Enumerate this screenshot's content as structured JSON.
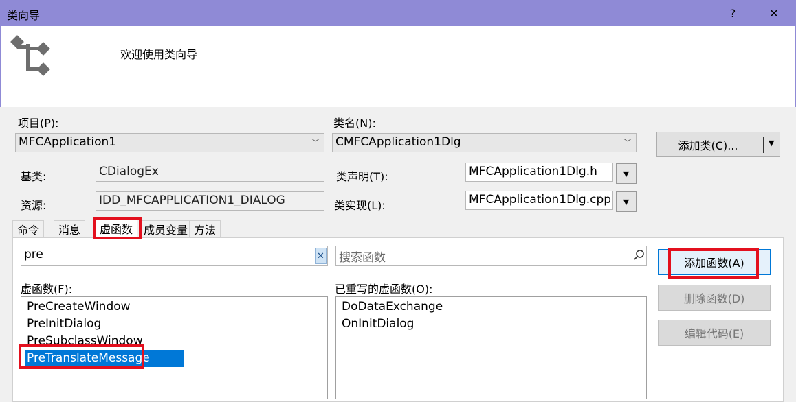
{
  "window": {
    "title": "类向导",
    "help_label": "?",
    "close_label": "✕"
  },
  "banner": {
    "welcome": "欢迎使用类向导",
    "icon": "class-hierarchy-icon"
  },
  "project": {
    "label": "项目(P):",
    "value": "MFCApplication1"
  },
  "classname": {
    "label": "类名(N):",
    "value": "CMFCApplication1Dlg"
  },
  "add_class_label": "添加类(C)...",
  "base_class": {
    "label": "基类:",
    "value": "CDialogEx"
  },
  "resource": {
    "label": "资源:",
    "value": "IDD_MFCAPPLICATION1_DIALOG"
  },
  "class_decl": {
    "label": "类声明(T):",
    "value": "MFCApplication1Dlg.h"
  },
  "class_impl": {
    "label": "类实现(L):",
    "value": "MFCApplication1Dlg.cpp"
  },
  "tabs": [
    "命令",
    "消息",
    "虚函数",
    "成员变量",
    "方法"
  ],
  "active_tab": "虚函数",
  "filter": {
    "value": "pre",
    "clear_label": "✕"
  },
  "search": {
    "placeholder": "搜索函数"
  },
  "virtual_functions": {
    "label": "虚函数(F):",
    "items": [
      "PreCreateWindow",
      "PreInitDialog",
      "PreSubclassWindow",
      "PreTranslateMessage"
    ],
    "selected": "PreTranslateMessage"
  },
  "overridden": {
    "label": "已重写的虚函数(O):",
    "items": [
      "DoDataExchange",
      "OnInitDialog"
    ]
  },
  "buttons": {
    "add_function": "添加函数(A)",
    "delete_function": "删除函数(D)",
    "edit_code": "编辑代码(E)"
  },
  "colors": {
    "titlebar": "#8f8ad6",
    "highlight": "#e3101e",
    "selection": "#0078d7"
  }
}
